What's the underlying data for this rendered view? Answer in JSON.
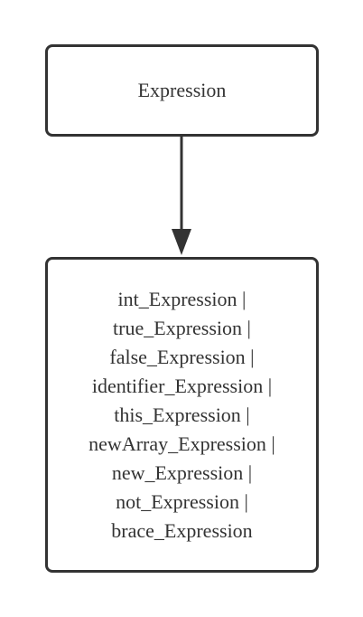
{
  "diagram": {
    "source_node": {
      "label": "Expression"
    },
    "target_node": {
      "alternatives": [
        "int_Expression |",
        "true_Expression |",
        "false_Expression |",
        "identifier_Expression |",
        "this_Expression |",
        "newArray_Expression |",
        "new_Expression |",
        "not_Expression |",
        "brace_Expression"
      ]
    },
    "edge": {
      "from": "source_node",
      "to": "target_node",
      "style": "solid-arrow"
    },
    "colors": {
      "stroke": "#333333",
      "background": "#ffffff",
      "text": "#333333"
    }
  }
}
